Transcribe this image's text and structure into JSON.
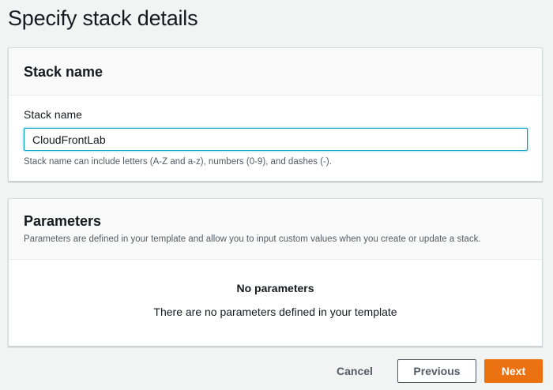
{
  "page": {
    "title": "Specify stack details"
  },
  "stack_panel": {
    "title": "Stack name",
    "field_label": "Stack name",
    "field_value": "CloudFrontLab",
    "hint": "Stack name can include letters (A-Z and a-z), numbers (0-9), and dashes (-)."
  },
  "parameters_panel": {
    "title": "Parameters",
    "description": "Parameters are defined in your template and allow you to input custom values when you create or update a stack.",
    "empty_title": "No parameters",
    "empty_description": "There are no parameters defined in your template"
  },
  "footer": {
    "cancel_label": "Cancel",
    "previous_label": "Previous",
    "next_label": "Next"
  },
  "colors": {
    "primary_button": "#ec7211",
    "focus_border": "#00a1c9",
    "background": "#f2f3f3"
  }
}
